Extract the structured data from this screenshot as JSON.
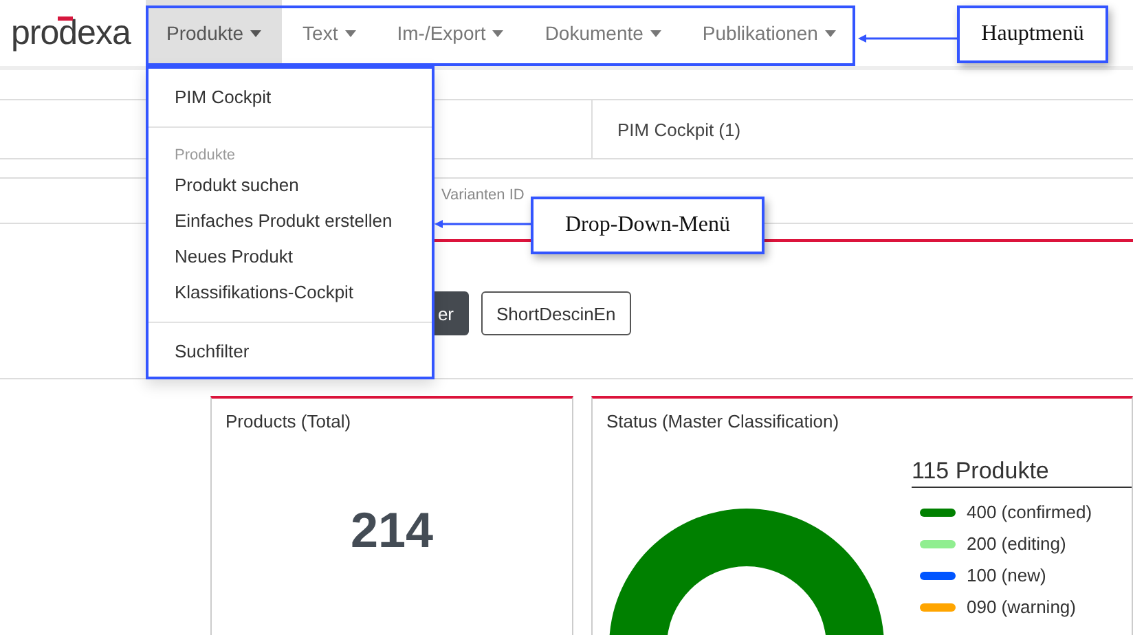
{
  "logo": "prodexa",
  "main_menu": [
    {
      "label": "Produkte",
      "selected": true
    },
    {
      "label": "Text",
      "selected": false
    },
    {
      "label": "Im-/Export",
      "selected": false
    },
    {
      "label": "Dokumente",
      "selected": false
    },
    {
      "label": "Publikationen",
      "selected": false
    }
  ],
  "dropdown": [
    {
      "kind": "item",
      "label": "PIM Cockpit"
    },
    {
      "kind": "divider"
    },
    {
      "kind": "header",
      "label": "Produkte"
    },
    {
      "kind": "item",
      "label": "Produkt suchen"
    },
    {
      "kind": "item",
      "label": "Einfaches Produkt erstellen"
    },
    {
      "kind": "item",
      "label": "Neues Produkt"
    },
    {
      "kind": "item",
      "label": "Klassifikations-Cockpit"
    },
    {
      "kind": "divider"
    },
    {
      "kind": "item",
      "label": "Suchfilter"
    }
  ],
  "tabs": [
    {
      "label": "PIM Cockpit (1)",
      "selected": true
    }
  ],
  "search": {
    "placeholder": "Varianten ID"
  },
  "buttons": [
    {
      "label": "er",
      "kind": "dark"
    },
    {
      "label": "ShortDescinEn",
      "kind": "outline"
    }
  ],
  "cards": [
    {
      "title": "Products (Total)",
      "value": "214"
    },
    {
      "title": "Status (Master Classification)",
      "legend_title": "115 Produkte",
      "legend": [
        {
          "label": "400 (confirmed)",
          "color": "#008000"
        },
        {
          "label": "200 (editing)",
          "color": "#90ee90"
        },
        {
          "label": "100 (new)",
          "color": "#0055ff"
        },
        {
          "label": "090 (warning)",
          "color": "#ffa500"
        }
      ]
    }
  ],
  "annotations": [
    {
      "label": "Hauptmenü"
    },
    {
      "label": "Drop-Down-Menü"
    }
  ]
}
